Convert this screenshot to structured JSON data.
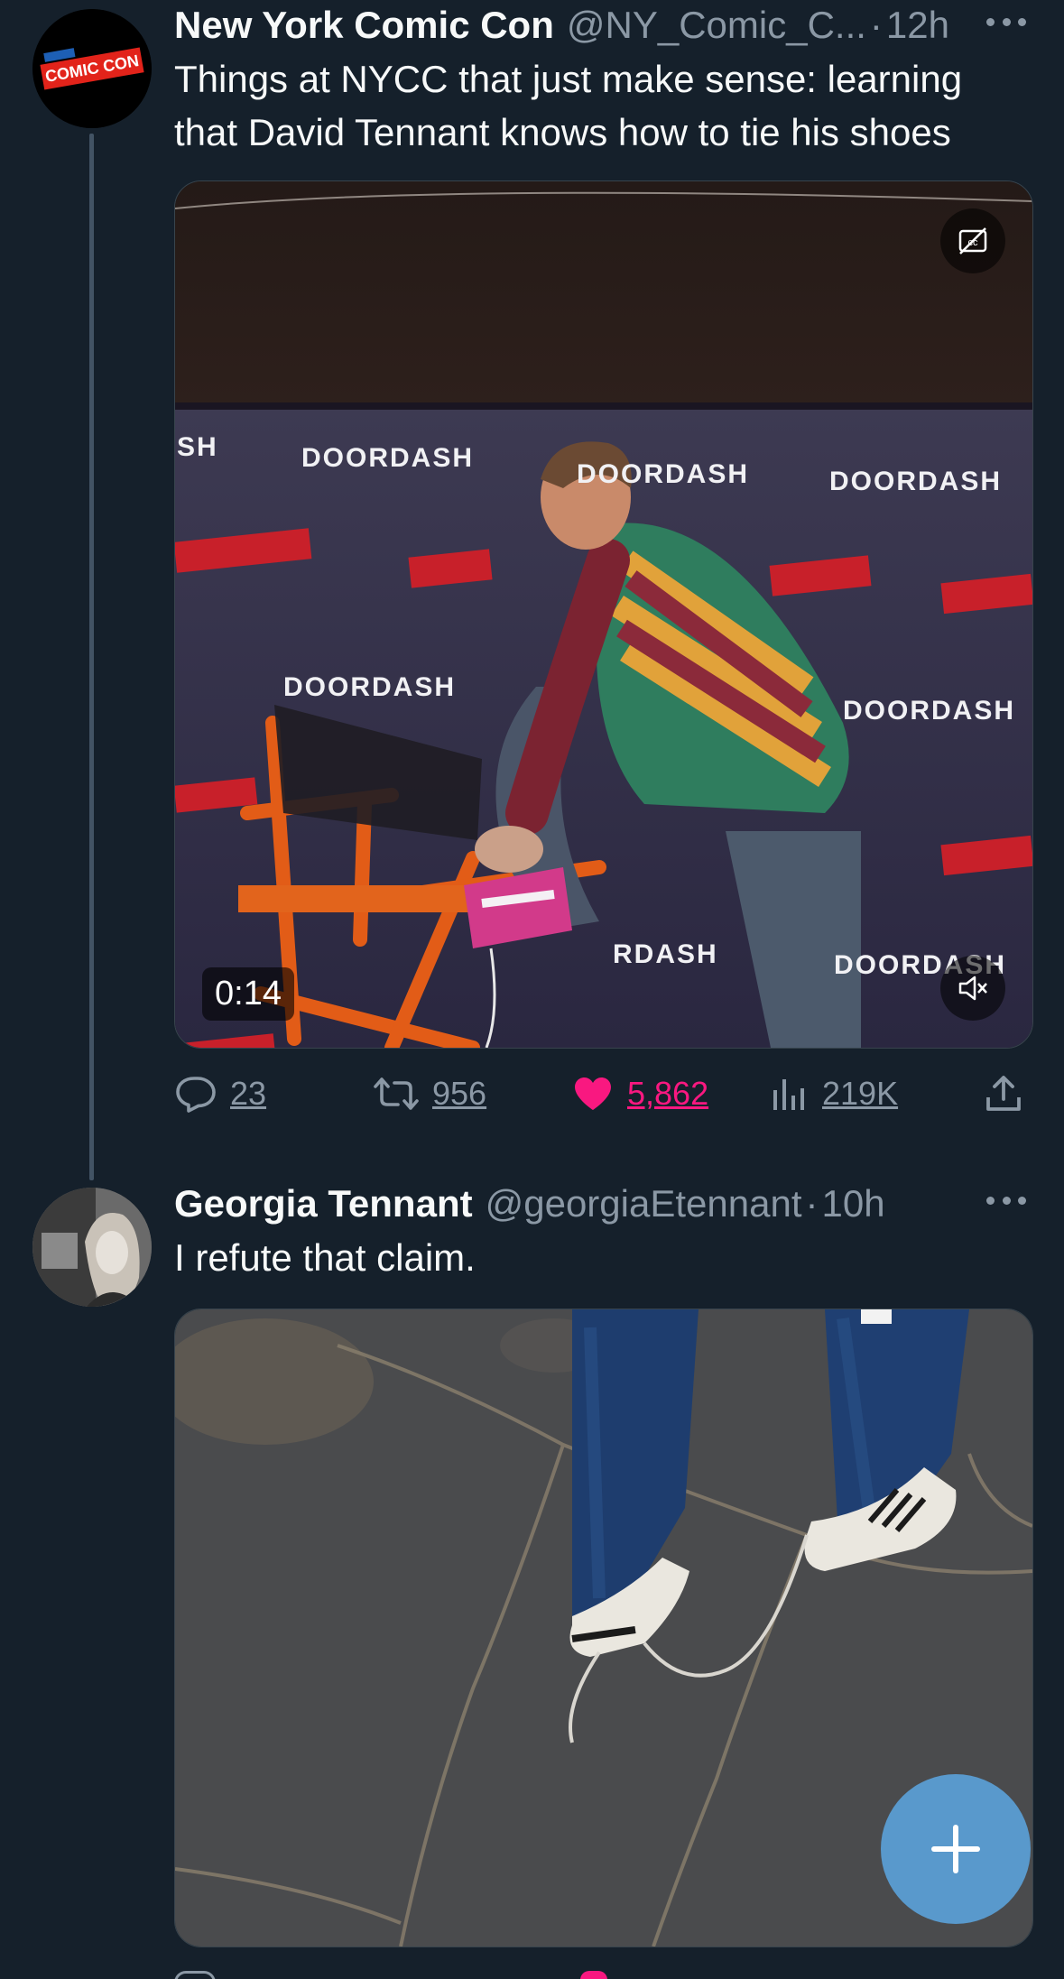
{
  "tweets": [
    {
      "name": "New York Comic Con",
      "handle": "@NY_Comic_C...",
      "separator": "·",
      "time": "12h",
      "text_line1": "Things at NYCC that just make sense: learning",
      "text_line2": "that David Tennant knows how to tie his shoes",
      "video": {
        "duration": "0:14",
        "banner_words": [
          "SH",
          "DOORDASH",
          "DOORDASH",
          "DOORDASH",
          "DOORDASH",
          "DOORDASH",
          "RDASH",
          "DOORDASH"
        ]
      },
      "stats": {
        "replies": "23",
        "retweets": "956",
        "likes": "5,862",
        "views": "219K"
      },
      "liked": true,
      "like_color": "#f91880"
    },
    {
      "name": "Georgia Tennant",
      "handle": "@georgiaEtennant",
      "separator": "·",
      "time": "10h",
      "text": "I refute that claim."
    }
  ],
  "colors": {
    "background": "#15202b",
    "secondary_text": "#8b98a5",
    "fab": "#5aa0d7"
  },
  "icons": [
    "avatar-nycc",
    "more-icon",
    "captions-off-icon",
    "mute-icon",
    "reply-icon",
    "retweet-icon",
    "heart-icon",
    "views-icon",
    "share-icon",
    "compose-plus-icon"
  ]
}
